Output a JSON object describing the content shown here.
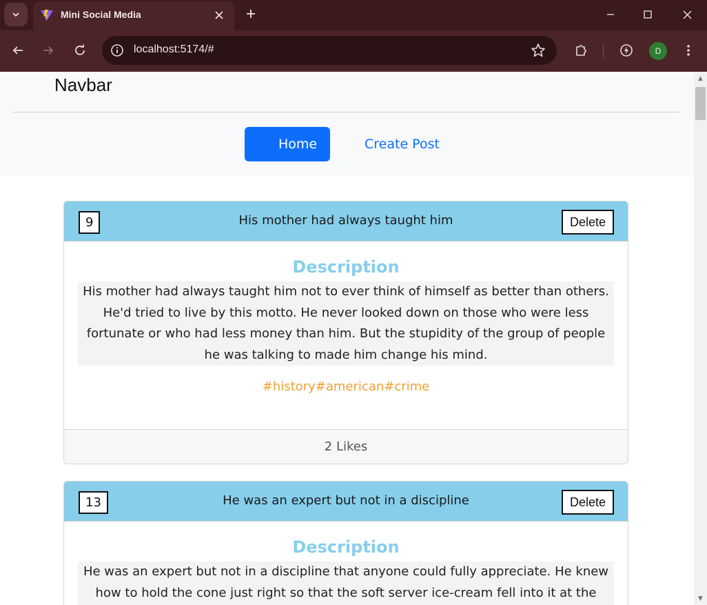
{
  "browser": {
    "tab_title": "Mini Social Media",
    "url": "localhost:5174/#",
    "profile_initial": "D"
  },
  "navbar": {
    "brand": "Navbar",
    "links": [
      {
        "label": "Home",
        "active": true
      },
      {
        "label": "Create Post",
        "active": false
      }
    ]
  },
  "posts": [
    {
      "id": "9",
      "title": "His mother had always taught him",
      "delete_label": "Delete",
      "description_label": "Description",
      "description": "His mother had always taught him not to ever think of himself as better than others. He'd tried to live by this motto. He never looked down on those who were less fortunate or who had less money than him. But the stupidity of the group of people he was talking to made him change his mind.",
      "tags": "#history#american#crime",
      "likes": "2 Likes"
    },
    {
      "id": "13",
      "title": "He was an expert but not in a discipline",
      "delete_label": "Delete",
      "description_label": "Description",
      "description": "He was an expert but not in a discipline that anyone could fully appreciate. He knew how to hold the cone just right so that the soft server ice-cream fell into it at the precise",
      "tags": "",
      "likes": ""
    }
  ],
  "colors": {
    "primary": "#0d6efd",
    "card_header": "#87ceeb",
    "tag": "#f0a030",
    "chrome_dark": "#3b1a1c"
  }
}
